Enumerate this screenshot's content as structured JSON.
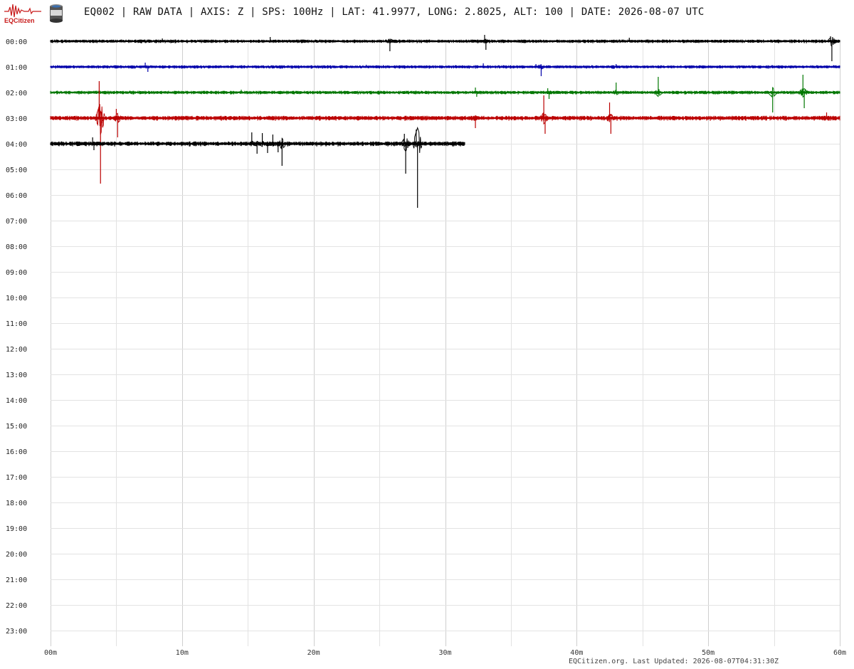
{
  "header": {
    "logo_text": "EQCitizen",
    "title": "EQ002 | RAW DATA | AXIS: Z | SPS: 100Hz | LAT: 41.9977, LONG: 2.8025, ALT: 100 | DATE: 2026-08-07 UTC"
  },
  "footer": {
    "text": "EQCitizen.org. Last Updated: 2026-08-07T04:31:30Z"
  },
  "chart_data": {
    "type": "line",
    "title": "EQ002 | RAW DATA | AXIS: Z | SPS: 100Hz | LAT: 41.9977, LONG: 2.8025, ALT: 100 | DATE: 2026-08-07 UTC",
    "x_ticks": [
      "00m",
      "10m",
      "20m",
      "30m",
      "40m",
      "50m",
      "60m"
    ],
    "x_range": [
      0,
      60
    ],
    "y_ticks": [
      "00:00",
      "01:00",
      "02:00",
      "03:00",
      "04:00",
      "05:00",
      "06:00",
      "07:00",
      "08:00",
      "09:00",
      "10:00",
      "11:00",
      "12:00",
      "13:00",
      "14:00",
      "15:00",
      "16:00",
      "17:00",
      "18:00",
      "19:00",
      "20:00",
      "21:00",
      "22:00",
      "23:00"
    ],
    "grid": true,
    "series": [
      {
        "row": "00:00",
        "color": "#000000",
        "end_minute": 60,
        "noise": 1.6,
        "events": [
          {
            "minute": 8.5,
            "amp": 4
          },
          {
            "minute": 16.7,
            "amp": 6
          },
          {
            "minute": 25.8,
            "amp": -14
          },
          {
            "minute": 33.0,
            "amp": 9
          },
          {
            "minute": 33.1,
            "amp": -12
          },
          {
            "minute": 44.0,
            "amp": 5
          },
          {
            "minute": 59.3,
            "amp": 7
          },
          {
            "minute": 59.4,
            "amp": -28
          }
        ]
      },
      {
        "row": "01:00",
        "color": "#0000aa",
        "end_minute": 60,
        "noise": 1.5,
        "events": [
          {
            "minute": 7.2,
            "amp": 6
          },
          {
            "minute": 7.4,
            "amp": -7
          },
          {
            "minute": 24.0,
            "amp": 3
          },
          {
            "minute": 32.9,
            "amp": 5
          },
          {
            "minute": 36.9,
            "amp": 4
          },
          {
            "minute": 37.3,
            "amp": -13
          },
          {
            "minute": 43.0,
            "amp": 4
          }
        ]
      },
      {
        "row": "02:00",
        "color": "#007700",
        "end_minute": 60,
        "noise": 1.6,
        "events": [
          {
            "minute": 14.5,
            "amp": 4
          },
          {
            "minute": 32.3,
            "amp": 7
          },
          {
            "minute": 32.4,
            "amp": -6
          },
          {
            "minute": 37.8,
            "amp": 6
          },
          {
            "minute": 37.9,
            "amp": -9
          },
          {
            "minute": 43.0,
            "amp": 14
          },
          {
            "minute": 46.2,
            "amp": 22
          },
          {
            "minute": 54.9,
            "amp": -28
          },
          {
            "minute": 57.2,
            "amp": 25
          },
          {
            "minute": 57.3,
            "amp": -22
          }
        ]
      },
      {
        "row": "03:00",
        "color": "#bb0000",
        "end_minute": 60,
        "noise": 2.2,
        "events": [
          {
            "minute": 3.7,
            "amp": 52
          },
          {
            "minute": 3.8,
            "amp": -92
          },
          {
            "minute": 5.0,
            "amp": 13
          },
          {
            "minute": 5.1,
            "amp": -27
          },
          {
            "minute": 32.3,
            "amp": -14
          },
          {
            "minute": 37.5,
            "amp": 32
          },
          {
            "minute": 37.6,
            "amp": -22
          },
          {
            "minute": 42.5,
            "amp": 22
          },
          {
            "minute": 42.6,
            "amp": -22
          },
          {
            "minute": 59.0,
            "amp": 8
          }
        ]
      },
      {
        "row": "04:00",
        "color": "#000000",
        "end_minute": 31.5,
        "noise": 2.2,
        "events": [
          {
            "minute": 3.2,
            "amp": 9
          },
          {
            "minute": 3.3,
            "amp": -9
          },
          {
            "minute": 15.3,
            "amp": 16
          },
          {
            "minute": 15.7,
            "amp": -14
          },
          {
            "minute": 16.1,
            "amp": 15
          },
          {
            "minute": 16.5,
            "amp": -13
          },
          {
            "minute": 16.9,
            "amp": 13
          },
          {
            "minute": 17.3,
            "amp": -12
          },
          {
            "minute": 17.6,
            "amp": -31
          },
          {
            "minute": 26.9,
            "amp": 14
          },
          {
            "minute": 27.0,
            "amp": -42
          },
          {
            "minute": 27.8,
            "amp": 20
          },
          {
            "minute": 27.9,
            "amp": -90
          }
        ]
      }
    ]
  }
}
